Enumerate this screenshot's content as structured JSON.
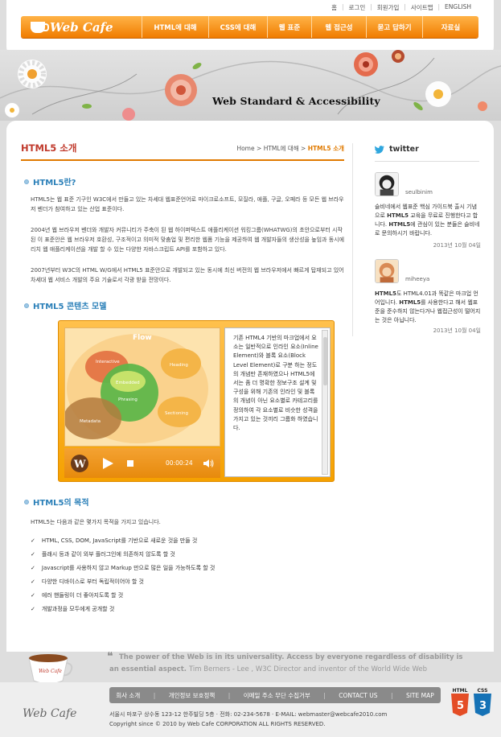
{
  "header": {
    "util_links": [
      "홈",
      "로그인",
      "회원가입",
      "사이트맵",
      "ENGLISH"
    ],
    "logo_text": "Web Cafe",
    "menu": [
      "HTML에 대해",
      "CSS에 대해",
      "웹 표준",
      "웹 접근성",
      "묻고 답하기",
      "자료실"
    ],
    "visual_title": "Web Standard & Accessibility"
  },
  "content": {
    "page_title": "HTML5 소개",
    "breadcrumb": {
      "home": "Home",
      "parent": "HTML에 대해",
      "current": "HTML5 소개",
      "sep": ">"
    },
    "section1": {
      "title": "HTML5란?",
      "paragraphs": [
        "HTML5는 웹 표준 기구인 W3C에서 만들고 있는 차세대 웹표준언어로 마이크로소프트, 모질라, 애플, 구글, 오페라 등 모든 웹 브라우저 벤더가 참여하고 있는 산업 표준이다.",
        "2004년 웹 브라우저 벤더와 개발자 커뮤니티가 주축이 된 웹 하이퍼텍스트 애플리케이션 워킹그룹(WHATWG)의 초안으로부터 시작된 이 표준안은 웹 브라우저 호환성, 구조적이고 의미적 맞춤업 및 편리한 웹폼 기능을 제공하여 웹 개발자들의 생산성을 높임과 동시에 리치 웹 애플리케이션을 개발 할 수 있는 다양한 자바스크립트 API를 포함하고 있다.",
        "2007년부터 W3C의 HTML W/G에서 HTML5 표준안으로 개발되고 있는 동시에 최신 버전의 웹 브라우저에서 빠르게 탑재되고 있어 차세대 웹 서비스 개발의 주요 기술로서 각광 받을 전망이다."
      ]
    },
    "section2": {
      "title": "HTML5 콘텐츠 모델",
      "diagram_labels": {
        "flow": "Flow",
        "interactive": "Interactive",
        "heading": "Heading",
        "embedded": "Embedded",
        "phrasing": "Phrasing",
        "metadata": "Metadata",
        "sectioning": "Sectioning"
      },
      "player_time": "00:00:24",
      "player_description": "기존 HTML4 기반의 마크업에서 요소는 일반적으로 인라인 요소(Inline Element)와 블록 요소(Block Level Element)로 구분 하는 정도의 개념만 존재하였으나 HTML5에서는 좀 더 명확한 정보구조 설계 및 구성을 위해 기존의 인라인 및 블록의 개념이 아닌 요소별로 카테고리를 정의하여 각 요소별로 비슷한 성격을 가지고 있는 것끼리 그룹화 하였습니다."
    },
    "section3": {
      "title": "HTML5의 목적",
      "intro": "HTML5는 다음과 같은 몇가지 목적을 가지고 있습니다.",
      "items": [
        "HTML, CSS, DOM, JavaScript를 기반으로 새로운 것을 만들 것",
        "플래시 등과 같이 외부 플러그인에 의존하지 않도록 할 것",
        "Javascript를 사용하지 않고 Markup 만으로 많은 일을 가능하도록 할 것",
        "다양한 디바이스로 부터 독립적이어야 할 것",
        "에러 핸들링이 더 좋아지도록 할 것",
        "개발과정을 모두에게 공개할 것"
      ]
    }
  },
  "twitter": {
    "title": "twitter",
    "tweets": [
      {
        "user": "seulbinim",
        "body_parts": [
          "슬비네에서 웹표준 핵심 가이드북 출시 기념으로 ",
          "HTML5",
          " 교육을 무료로 진행한다고 합니다. ",
          "HTML5",
          "에 관심이 있는 분들은 슬비네로 문의하시기 바랍니다."
        ],
        "date": "2013년 10월 04일"
      },
      {
        "user": "miheeya",
        "body_parts": [
          "HTML5",
          "도 HTML4.01과 똑같은 마크업 언어입니다. ",
          "HTML5",
          "를 사용한다고 해서 웹표준을 준수하지 않는다거나 웹접근성이 떨어지는 것은 아닙니다."
        ],
        "date": "2013년 10월 04일"
      }
    ]
  },
  "footer": {
    "quote": "The power of the Web is in its universality. Access by everyone regardless of disability is an essential aspect.",
    "quote_author": "Tim Berners - Lee , W3C Director and inventor of the World Wide Web",
    "cup_label": "Web Cafe",
    "nav": [
      "회사 소개",
      "개인정보 보호정책",
      "이메일 주소 무단 수집거부",
      "CONTACT US",
      "SITE MAP"
    ],
    "logo": "Web Cafe",
    "address": "서울시 마포구 상수동 123-12 한주빌딩 5층  · 전화: 02-234-5678  · E-MAIL: webmaster@webcafe2010.com",
    "copyright": "Copyright since © 2010 by Web Cafe CORPORATION ALL RIGHTS RESERVED.",
    "badges": [
      "HTML",
      "CSS"
    ]
  },
  "colors": {
    "accent_orange": "#f07c00",
    "title_red": "#c0392b",
    "section_blue": "#2a7fb8",
    "html5_badge": "#e44d26",
    "css3_badge": "#1572b6"
  }
}
